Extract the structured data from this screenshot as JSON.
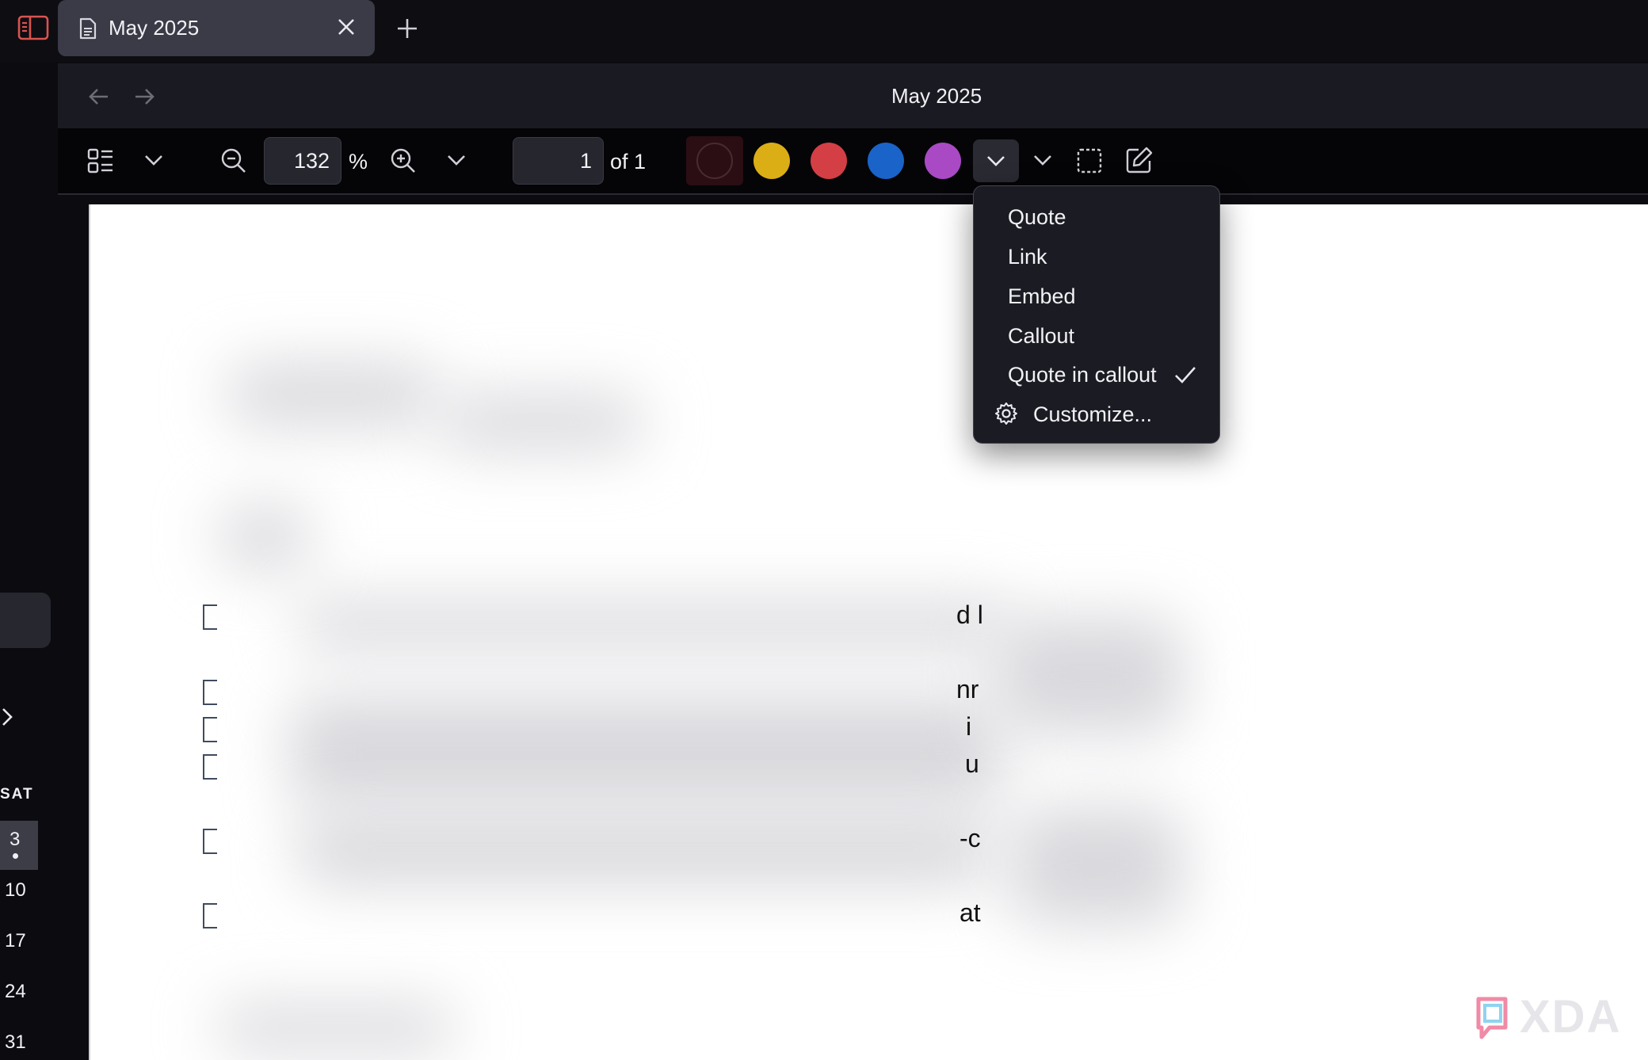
{
  "tab": {
    "title": "May 2025"
  },
  "header": {
    "title": "May 2025"
  },
  "toolbar": {
    "zoom_value": "132",
    "zoom_unit": "%",
    "page_value": "1",
    "page_of": "of 1",
    "colors": [
      "#2a0e14",
      "#dcae16",
      "#d33f44",
      "#1a63c8",
      "#a94ac4"
    ]
  },
  "menu": {
    "items": [
      {
        "label": "Quote"
      },
      {
        "label": "Link"
      },
      {
        "label": "Embed"
      },
      {
        "label": "Callout"
      },
      {
        "label": "Quote in callout",
        "checked": true
      },
      {
        "label": "Customize..."
      }
    ]
  },
  "calendar": {
    "day_header": "SAT",
    "days": [
      "3",
      "10",
      "17",
      "24",
      "31"
    ]
  },
  "document": {
    "fragments": [
      "d l",
      "nr",
      "i",
      "u",
      "-c",
      "at"
    ]
  },
  "watermark": {
    "text": "XDA"
  }
}
